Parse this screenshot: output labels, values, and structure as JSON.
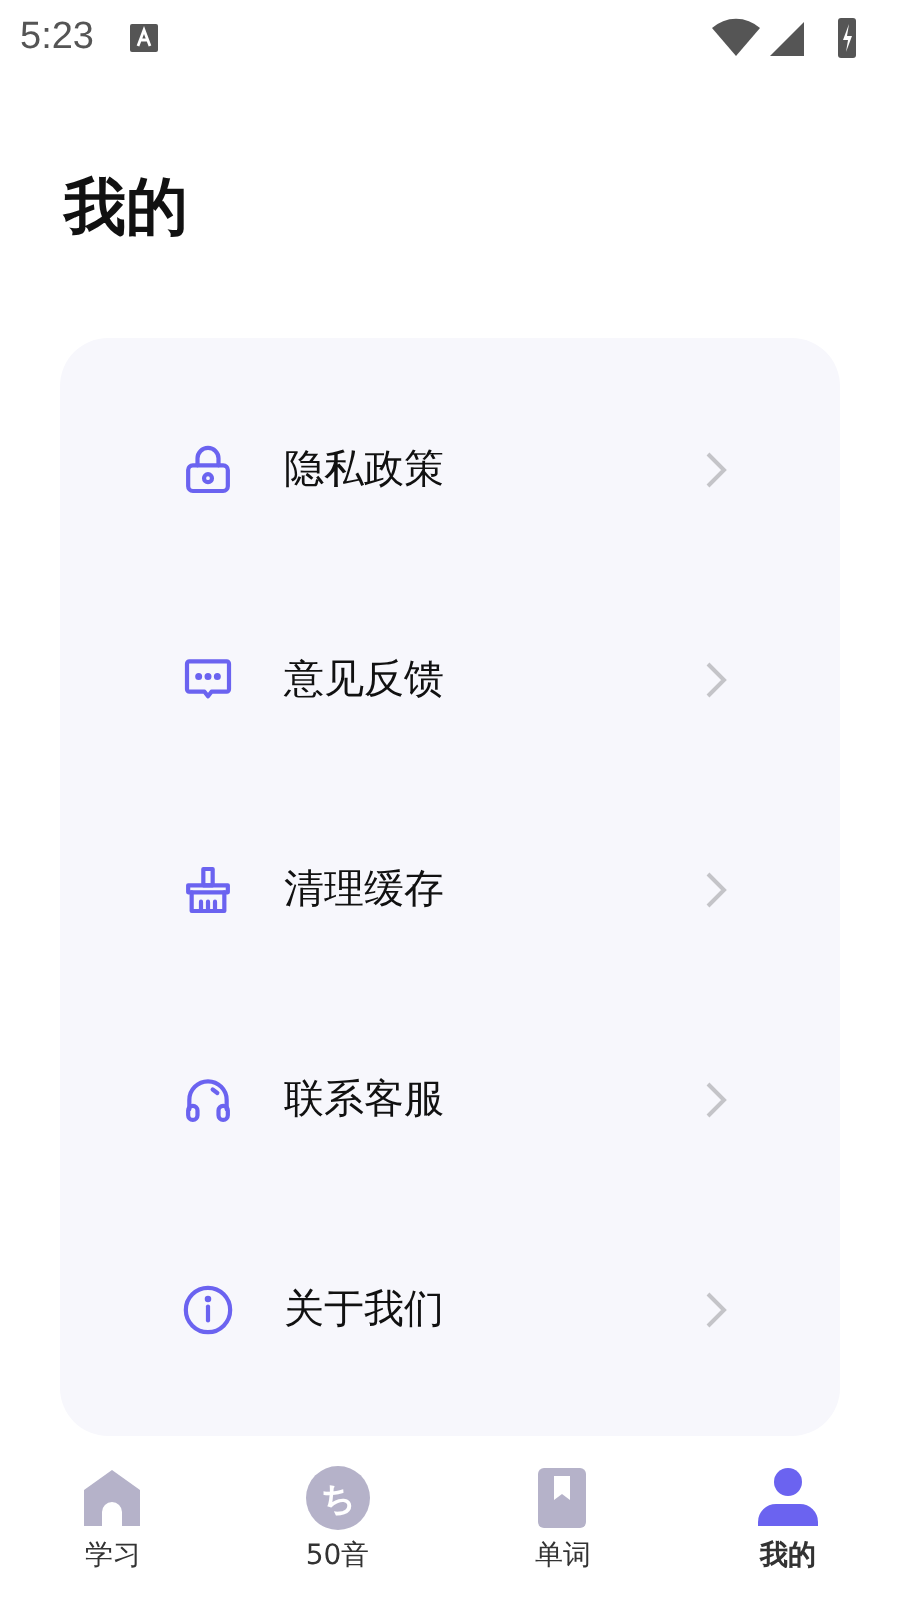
{
  "status_bar": {
    "time": "5:23"
  },
  "title": "我的",
  "menu": [
    {
      "kind": "lock",
      "label": "隐私政策"
    },
    {
      "kind": "chat",
      "label": "意见反馈"
    },
    {
      "kind": "broom",
      "label": "清理缓存"
    },
    {
      "kind": "headset",
      "label": "联系客服"
    },
    {
      "kind": "info",
      "label": "关于我们"
    }
  ],
  "tab_bar": [
    {
      "kind": "home",
      "label": "学习",
      "selected": false
    },
    {
      "kind": "kana",
      "label": "50音",
      "glyph": "ち",
      "selected": false
    },
    {
      "kind": "book",
      "label": "单词",
      "selected": false
    },
    {
      "kind": "person",
      "label": "我的",
      "selected": true
    }
  ]
}
